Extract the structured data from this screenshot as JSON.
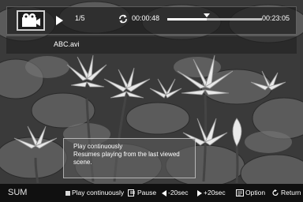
{
  "player": {
    "page_count": "1/5",
    "current_time": "00:00:48",
    "total_time": "00:23:05",
    "progress": 0.42,
    "file_name": "ABC.avi"
  },
  "tooltip": {
    "title": "Play continuously",
    "description_line1": "Resumes playing from the last viewed",
    "description_line2": "scene."
  },
  "guide": {
    "sum_label": "SUM",
    "items": [
      {
        "label": "Play continuously",
        "icon": "square-icon"
      },
      {
        "label": "Pause",
        "icon": "pause-icon"
      },
      {
        "label": "-20sec",
        "icon": "rewind-arrow-icon"
      },
      {
        "label": "+20sec",
        "icon": "forward-arrow-icon"
      },
      {
        "label": "Option",
        "icon": "option-icon"
      },
      {
        "label": "Return",
        "icon": "return-icon"
      }
    ]
  },
  "colors": {
    "overlay": "#1e1e1e",
    "guide_bar": "#101010",
    "text": "#ffffff"
  }
}
